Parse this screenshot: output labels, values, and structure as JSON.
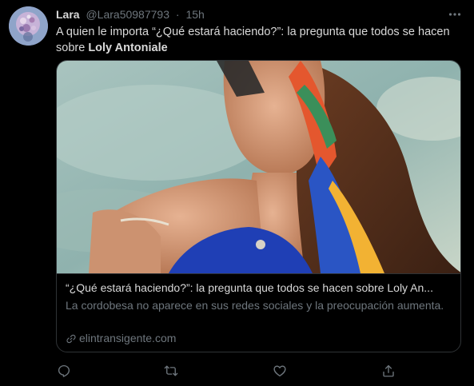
{
  "tweet": {
    "author_name": "Lara",
    "author_handle": "@Lara50987793",
    "separator": "·",
    "time": "15h",
    "text_part1": "A quien  le importa “¿Qué estará haciendo?”: la pregunta que todos se hacen sobre ",
    "text_bold": "Loly Antoniale"
  },
  "card": {
    "title": "“¿Qué estará haciendo?”: la pregunta que todos se hacen sobre Loly An...",
    "description": "La cordobesa no aparece en sus redes sociales y la preocupación aumenta.",
    "domain": "elintransigente.com"
  },
  "icons": {
    "more": "more-horizontal-icon",
    "reply": "reply-icon",
    "retweet": "retweet-icon",
    "like": "heart-icon",
    "share": "share-icon",
    "link": "link-icon"
  },
  "colors": {
    "background": "#000000",
    "primary_text": "#d9d9d9",
    "secondary_text": "#6e767d",
    "border": "#2f3336"
  }
}
